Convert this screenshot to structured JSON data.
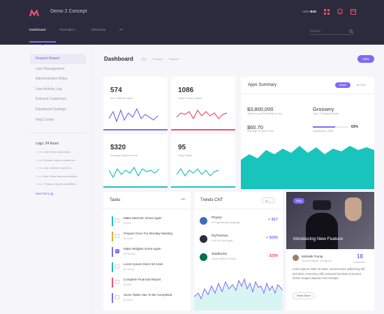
{
  "app": {
    "title": "Demo 2 Concept",
    "hello": "Hello",
    "user": "Bob"
  },
  "nav": {
    "items": [
      "Dashboard",
      "Extended",
      "Elements",
      "•••"
    ],
    "search_placeholder": "Search..."
  },
  "sidebar": {
    "items": [
      "Finance Report",
      "User Management",
      "Administrative Roles",
      "User Activity Log",
      "Extranet Customers",
      "Dashboard Settings",
      "Help Center"
    ],
    "logs_title": "Logs: 24 hours",
    "logs": [
      {
        "time": "1 min",
        "text": "User Sean was active"
      },
      {
        "time": "1 min",
        "text": "Finance report created at..."
      },
      {
        "time": "2 min",
        "text": "John viewed reports in..."
      },
      {
        "time": "2 min",
        "text": "New Sean has been added..."
      },
      {
        "time": "1 hour",
        "text": "Finance report submitted..."
      }
    ],
    "see_full_log": "See Full Log"
  },
  "page": {
    "title": "Dashboard",
    "crumbs": [
      "Finance",
      "Reports"
    ],
    "new_button": "New"
  },
  "stats": [
    {
      "value": "574",
      "label": "All Contents Value",
      "color": "#7c6cf6"
    },
    {
      "value": "1086",
      "label": "Total Product Sales",
      "color": "#f0506e"
    },
    {
      "value": "$320",
      "label": "Average Daily Income",
      "color": "#19c4bd"
    },
    {
      "value": "95",
      "label": "Daily Sales",
      "color": "#19c4bd"
    }
  ],
  "apps_summary": {
    "title": "Apps Summary",
    "tabs": [
      "Month",
      "All Time"
    ],
    "metrics": [
      {
        "value": "$3,800,000",
        "label": "Total Annual Profit Before Tax"
      },
      {
        "value": "Grossery",
        "label": "Type Of Market Share"
      },
      {
        "value": "$60.70",
        "label": "Average Product Price"
      }
    ],
    "satisfaction": {
      "label": "Satisfication Rate",
      "percent": "63%",
      "fraction": 0.63
    }
  },
  "tasks": {
    "title": "Tasks",
    "more": "•••",
    "items": [
      {
        "title": "Make Metronic Great Again",
        "by": "By Bob",
        "color": "#19c4bd",
        "checked": false
      },
      {
        "title": "Prepare Docs For Monday Meeting",
        "by": "By Sean",
        "color": "#f5a623",
        "checked": false
      },
      {
        "title": "Make Widgets Great Again",
        "by": "By Sydney",
        "color": "#7c6cf6",
        "checked": true
      },
      {
        "title": "Lorem Ipsum Dolor Sit Amet",
        "by": "By James",
        "color": "#19c4bd",
        "checked": false
      },
      {
        "title": "Complete Financial Report",
        "by": "By Bob",
        "color": "#f0506e",
        "checked": false
      },
      {
        "title": "Some Tasks Has To Be Completed",
        "by": "By Sean",
        "color": "#7c6cf6",
        "checked": false
      }
    ]
  },
  "trends": {
    "title": "Trends CNT",
    "dropdown": "All",
    "items": [
      {
        "name": "Phyton",
        "sub": "A Programming Language",
        "value": "+ $17",
        "color": "#7c6cf6",
        "icon_bg": "#3b6fb6"
      },
      {
        "name": "FlyThemes",
        "sub": "Let's Fly Fast Again",
        "value": "+ $200",
        "color": "#7c6cf6",
        "icon_bg": "#2c2b3d"
      },
      {
        "name": "StarBucks",
        "sub": "Good Coffee & Snacks",
        "value": "- $290",
        "color": "#f0506e",
        "icon_bg": "#00704a"
      }
    ]
  },
  "blog": {
    "badge": "Blog",
    "title": "Introducing New Feature",
    "author": "Michelle Trump",
    "author_role": "Visual Designer, Google Inc",
    "comments_count": "18",
    "comments_label": "Comments",
    "text": "Lorem ipsum dolor sit amet, consectetuer adipiscing elit, sed diam nonummy nibh euismod tincidunt ut laoreet dolore magna aliquam erat volutpat",
    "button": "Read More"
  }
}
